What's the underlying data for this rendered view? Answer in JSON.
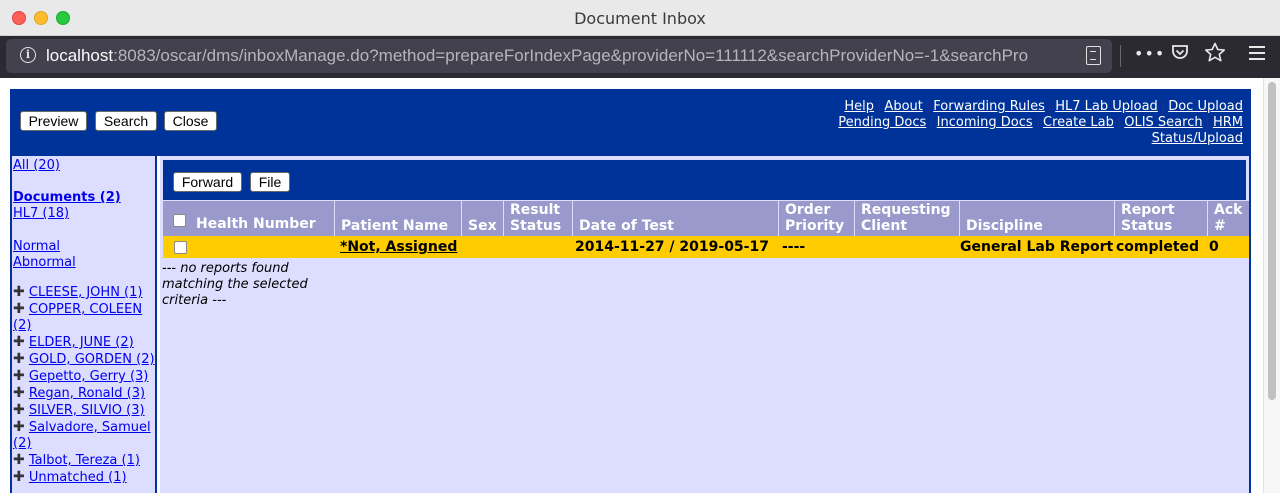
{
  "window": {
    "title": "Document Inbox"
  },
  "browser": {
    "url_host": "localhost",
    "url_rest": ":8083/oscar/dms/inboxManage.do?method=prepareForIndexPage&providerNo=111112&searchProviderNo=-1&searchPro",
    "icons": [
      "info-icon",
      "reader-view-icon",
      "more-icon",
      "pocket-icon",
      "bookmark-star-icon",
      "menu-icon"
    ]
  },
  "toolbar": {
    "preview": "Preview",
    "search": "Search",
    "close": "Close"
  },
  "links": {
    "row1": [
      "Help",
      "About",
      "Forwarding Rules",
      "HL7 Lab Upload",
      "Doc Upload"
    ],
    "row2": [
      "Pending Docs",
      "Incoming Docs",
      "Create Lab",
      "OLIS Search",
      "HRM"
    ],
    "row3": [
      "Status/Upload"
    ]
  },
  "sidebar": {
    "all": "All (20)",
    "documents": "Documents (2)",
    "hl7": "HL7 (18)",
    "normal": "Normal",
    "abnormal": "Abnormal",
    "patients": [
      "CLEESE, JOHN (1)",
      "COPPER, COLEEN (2)",
      "ELDER, JUNE (2)",
      "GOLD, GORDEN (2)",
      "Gepetto, Gerry (3)",
      "Regan, Ronald (3)",
      "SILVER, SILVIO (3)",
      "Salvadore, Samuel (2)",
      "Talbot, Tereza (1)",
      "Unmatched (1)"
    ]
  },
  "actions": {
    "forward": "Forward",
    "file": "File"
  },
  "table": {
    "headers": {
      "health_number": "Health Number",
      "patient_name": "Patient Name",
      "sex": "Sex",
      "result_status": "Result Status",
      "date_of_test": "Date of Test",
      "order_priority": "Order Priority",
      "requesting_client": "Requesting Client",
      "discipline": "Discipline",
      "report_status": "Report Status",
      "ack": "Ack #"
    },
    "rows": [
      {
        "health_number": "",
        "patient_name": "*Not, Assigned",
        "sex": "",
        "result_status": "",
        "date_of_test": "2014-11-27 / 2019-05-17",
        "order_priority": "----",
        "requesting_client": "",
        "discipline": "General Lab Report",
        "report_status": "completed",
        "ack": "0"
      }
    ],
    "row_color": "#ffcc00"
  },
  "no_reports": "--- no reports found matching the selected criteria ---",
  "colors": {
    "header_blue": "#003399",
    "panel": "#ddddff",
    "table_header": "#9999cc"
  }
}
